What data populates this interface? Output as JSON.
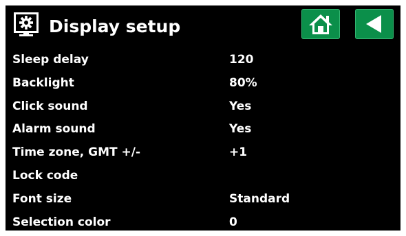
{
  "header": {
    "title": "Display setup",
    "icon": "display-monitor-icon",
    "home_icon": "home-icon",
    "back_icon": "back-arrow-icon"
  },
  "colors": {
    "background": "#000000",
    "text": "#ffffff",
    "button_green": "#0b8f4a"
  },
  "settings": [
    {
      "label": "Sleep delay",
      "value": "120"
    },
    {
      "label": "Backlight",
      "value": "80%"
    },
    {
      "label": "Click sound",
      "value": "Yes"
    },
    {
      "label": "Alarm sound",
      "value": "Yes"
    },
    {
      "label": "Time zone, GMT +/-",
      "value": "+1"
    },
    {
      "label": "Lock code",
      "value": ""
    },
    {
      "label": "Font size",
      "value": "Standard"
    },
    {
      "label": "Selection color",
      "value": "0"
    }
  ]
}
